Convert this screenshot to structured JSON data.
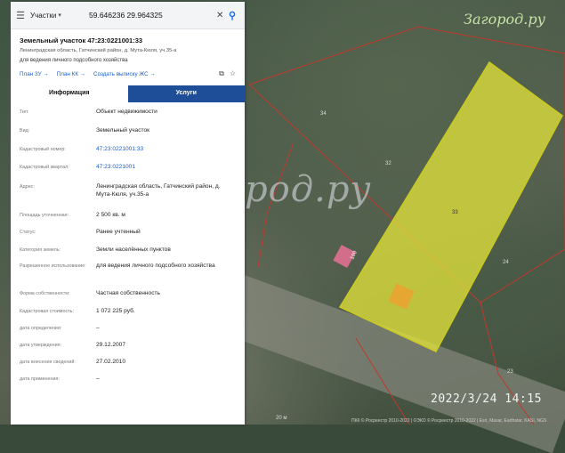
{
  "search": {
    "category": "Участки",
    "query": "59.646236 29.964325"
  },
  "parcel": {
    "title": "Земельный участок 47:23:0221001:33",
    "address": "Ленинградская область, Гатчинский район, д. Мута-Кюля, уч.35-а",
    "purpose": "для ведения личного подсобного хозяйства",
    "links": [
      "План ЗУ →",
      "План КК →",
      "Создать выписку ЖС →"
    ]
  },
  "tabs": [
    "Информация",
    "Услуги"
  ],
  "rows": [
    {
      "label": "Тип:",
      "value": "Объект недвижимости"
    },
    {
      "label": "Вид:",
      "value": "Земельный участок"
    },
    {
      "label": "Кадастровый номер:",
      "value": "47:23:0221001:33"
    },
    {
      "label": "Кадастровый квартал:",
      "value": "47:23:0221001"
    },
    {
      "label": "Адрес:",
      "value": "Ленинградская область, Гатчинский район, д. Мута-Кюля, уч.35-а"
    },
    {
      "label": "Площадь уточненная:",
      "value": "2 500 кв. м"
    },
    {
      "label": "Статус:",
      "value": "Ранее учтенный"
    },
    {
      "label": "Категория земель:",
      "value": "Земли населённых пунктов"
    },
    {
      "label": "Разрешенное использование:",
      "value": "для ведения личного подсобного хозяйства"
    },
    {
      "label": "Форма собственности:",
      "value": "Частная собственность"
    },
    {
      "label": "Кадастровая стоимость:",
      "value": "1 072 225 руб."
    },
    {
      "label": "дата определения:",
      "value": "–"
    },
    {
      "label": "дата утверждения:",
      "value": "29.12.2007"
    },
    {
      "label": "дата внесения сведений:",
      "value": "27.02.2010"
    },
    {
      "label": "дата применения:",
      "value": "–"
    }
  ],
  "map": {
    "watermark_top": "Загород.ру",
    "watermark_mid": "Загород.ру",
    "timestamp": "2022/3/24  14:15",
    "scale": "20 м",
    "copyright": "ПКК © Росреестр 2010-2022 | ©ЭКО © Росреестр 2010-2022 | Esri, Maxar, Earthstar, KASI, NGS",
    "labels": [
      "34",
      "32",
      "33",
      "100",
      "24",
      "23"
    ],
    "colors": {
      "highlight": "#e6e63a",
      "boundary": "#c0392b",
      "pink": "#e07090"
    }
  }
}
